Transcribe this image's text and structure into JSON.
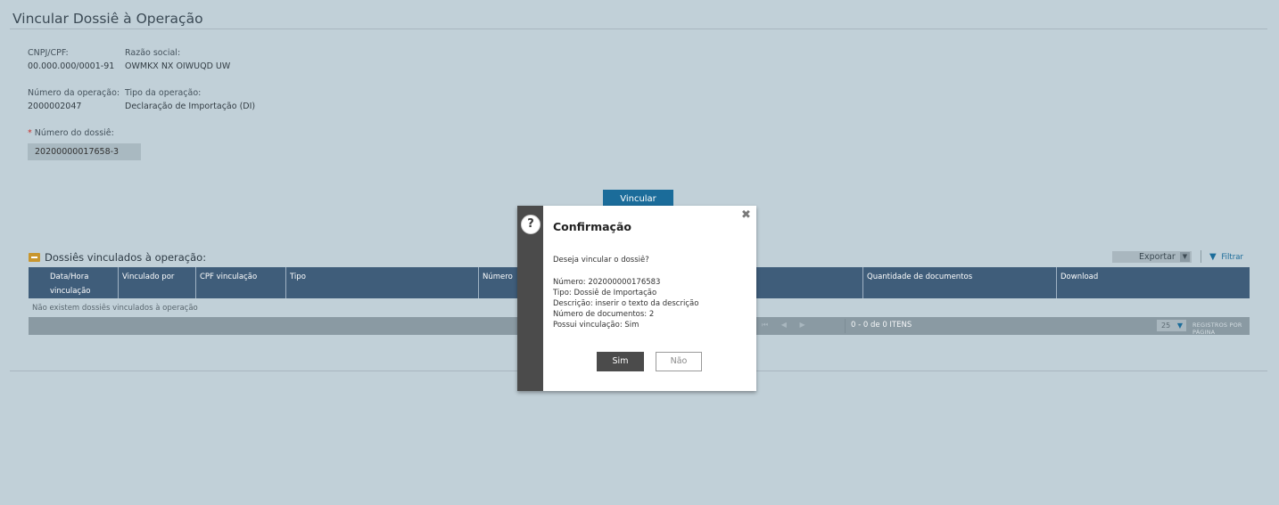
{
  "page": {
    "title": "Vincular Dossiê à Operação"
  },
  "fields": {
    "cnpj_label": "CNPJ/CPF:",
    "cnpj_value": "00.000.000/0001-91",
    "razao_label": "Razão social:",
    "razao_value": "OWMKX NX OIWUQD UW",
    "numero_operacao_label": "Número da operação:",
    "numero_operacao_value": "2000002047",
    "tipo_operacao_label": "Tipo da operação:",
    "tipo_operacao_value": "Declaração de Importação (DI)",
    "required_mark": "*",
    "numero_dossie_label": "Número do dossiê:",
    "numero_dossie_value": "20200000017658-3"
  },
  "actions": {
    "vincular_label": "Vincular"
  },
  "section": {
    "title": "Dossiês vinculados à operação:",
    "export_label": "Exportar",
    "filter_label": "Filtrar"
  },
  "table": {
    "columns": [
      "Data/Hora vinculação",
      "Vinculado por",
      "CPF vinculação",
      "Tipo",
      "Número",
      "",
      "Quantidade de documentos",
      "Download"
    ],
    "empty_message": "Não existem dossiês vinculados à operação"
  },
  "pager": {
    "info": "0 - 0 de 0 ITENS",
    "page_size": "25",
    "page_size_label": "REGISTROS POR PÁGINA"
  },
  "dialog": {
    "title": "Confirmação",
    "question": "Deseja vincular o dossiê?",
    "details": [
      "Número: 202000000176583",
      "Tipo: Dossiê de Importação",
      "Descrição: inserir o texto da descrição",
      "Número de documentos: 2",
      "Possui vinculação: Sim"
    ],
    "yes_label": "Sim",
    "no_label": "Não",
    "icon_glyph": "?",
    "close_glyph": "✖"
  },
  "colors": {
    "background": "#c1d0d8",
    "primary_button": "#1b6c9a",
    "grid_header": "#3f5d7a",
    "dialog_side": "#4b4b4b",
    "required": "#c8302c"
  }
}
